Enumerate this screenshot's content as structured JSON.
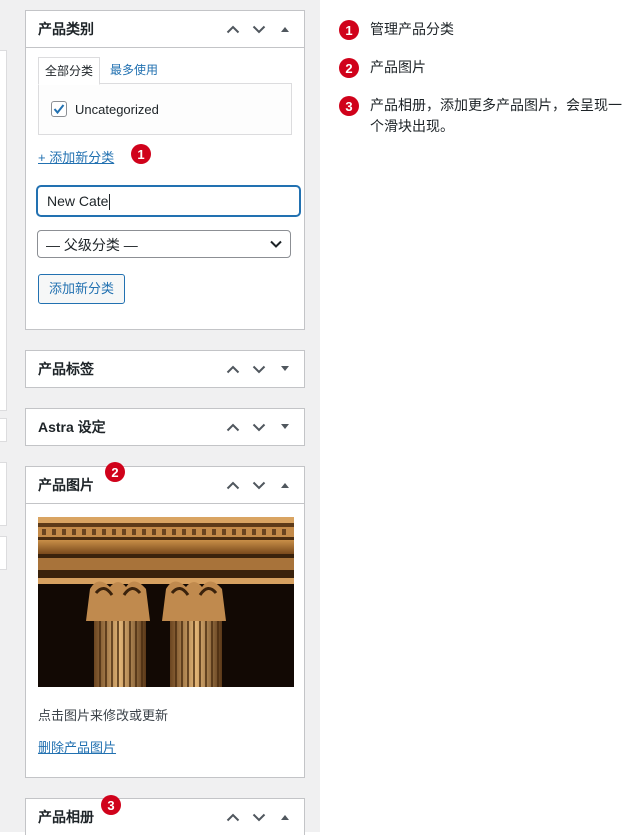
{
  "categories_box": {
    "title": "产品类别",
    "tabs": {
      "all": "全部分类",
      "most_used": "最多使用"
    },
    "items": [
      {
        "label": "Uncategorized",
        "checked": true
      }
    ],
    "add_new_link": "+ 添加新分类",
    "new_category_input": "New Cate",
    "parent_select": "— 父级分类 —",
    "add_button": "添加新分类"
  },
  "tags_box": {
    "title": "产品标签"
  },
  "astra_box": {
    "title": "Astra 设定"
  },
  "image_box": {
    "title": "产品图片",
    "caption": "点击图片来修改或更新",
    "remove_link": "删除产品图片"
  },
  "gallery_box": {
    "title": "产品相册"
  },
  "badges": [
    "1",
    "2",
    "3"
  ],
  "notes": [
    {
      "num": "1",
      "text": "管理产品分类"
    },
    {
      "num": "2",
      "text": "产品图片"
    },
    {
      "num": "3",
      "text": "产品相册，添加更多产品图片，会呈现一个滑块出现。"
    }
  ],
  "colors": {
    "accent": "#2271b1",
    "badge": "#d0021b",
    "background": "#f0f0f1"
  }
}
